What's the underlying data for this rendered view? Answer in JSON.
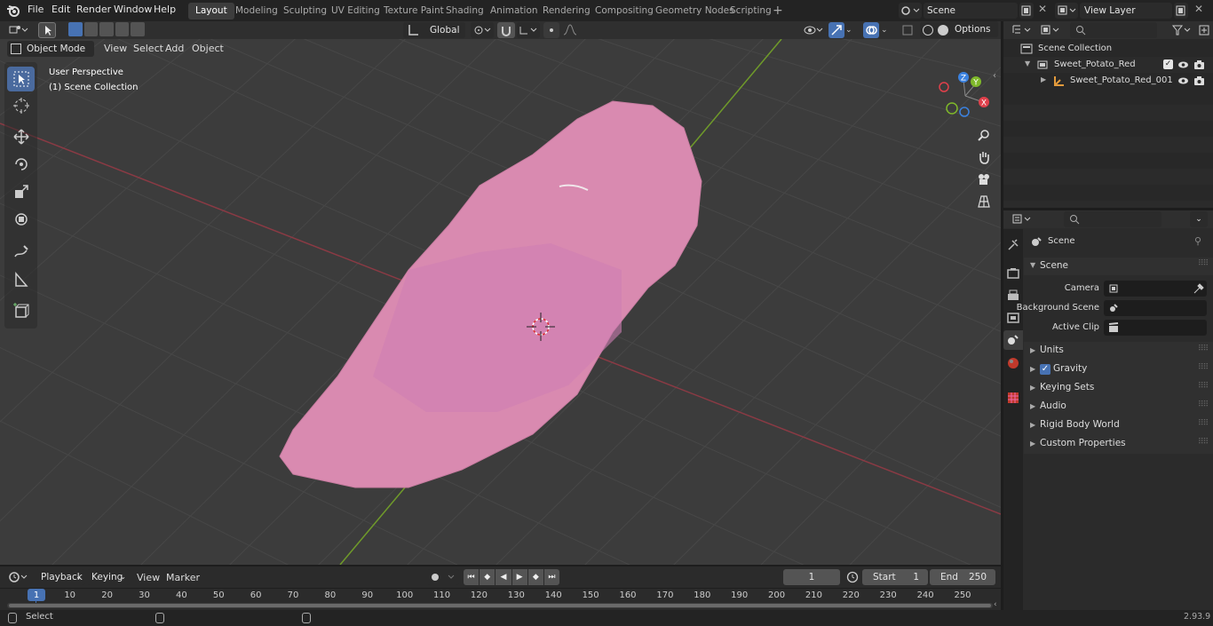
{
  "topbar": {
    "menus": [
      "File",
      "Edit",
      "Render",
      "Window",
      "Help"
    ],
    "workspaces": [
      "Layout",
      "Modeling",
      "Sculpting",
      "UV Editing",
      "Texture Paint",
      "Shading",
      "Animation",
      "Rendering",
      "Compositing",
      "Geometry Nodes",
      "Scripting"
    ],
    "active_workspace": "Layout",
    "scene_name": "Scene",
    "view_layer": "View Layer"
  },
  "viewport": {
    "mode": "Object Mode",
    "menus": [
      "View",
      "Select",
      "Add",
      "Object"
    ],
    "orientation": "Global",
    "options_label": "Options",
    "overlay_line1": "User Perspective",
    "overlay_line2": "(1) Scene Collection",
    "gizmo": {
      "x": "X",
      "y": "Y",
      "z": "Z"
    }
  },
  "outliner": {
    "root": "Scene Collection",
    "items": [
      {
        "label": "Sweet_Potato_Red"
      },
      {
        "label": "Sweet_Potato_Red_001"
      }
    ]
  },
  "properties": {
    "context": "Scene",
    "section": "Scene",
    "fields": [
      {
        "label": "Camera"
      },
      {
        "label": "Background Scene"
      },
      {
        "label": "Active Clip"
      }
    ],
    "panels": [
      "Units",
      "Gravity",
      "Keying Sets",
      "Audio",
      "Rigid Body World",
      "Custom Properties"
    ]
  },
  "timeline": {
    "menus": [
      "Playback",
      "Keying",
      "View",
      "Marker"
    ],
    "current_frame": "1",
    "start_label": "Start",
    "start": "1",
    "end_label": "End",
    "end": "250",
    "ticks": [
      "1",
      "10",
      "20",
      "30",
      "40",
      "50",
      "60",
      "70",
      "80",
      "90",
      "100",
      "110",
      "120",
      "130",
      "140",
      "150",
      "160",
      "170",
      "180",
      "190",
      "200",
      "210",
      "220",
      "230",
      "240",
      "250"
    ]
  },
  "status": {
    "select_label": "Select",
    "version": "2.93.9"
  },
  "colors": {
    "accent": "#4772b3",
    "potato": "#d98ab0",
    "x_axis": "#a13a44",
    "y_axis": "#6f9a2a",
    "viewport_bg": "#3c3c3c"
  }
}
